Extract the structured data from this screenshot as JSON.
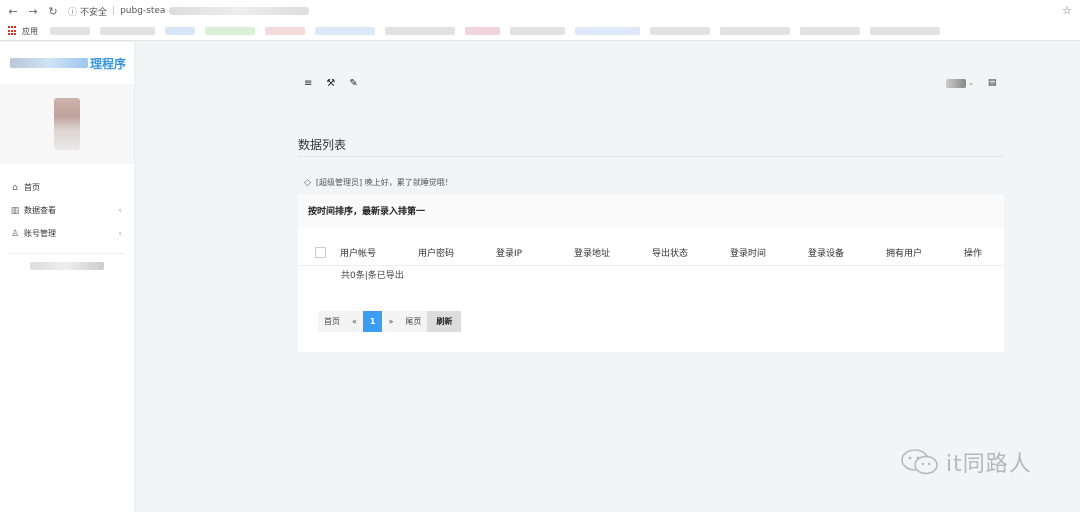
{
  "browser": {
    "security_label": "不安全",
    "url_text": "pubg-stea",
    "bookmarks_label": "应用"
  },
  "sidebar": {
    "brand_suffix": "理程序",
    "menu": [
      {
        "label": "首页",
        "icon": "home-icon"
      },
      {
        "label": "数据查看",
        "icon": "bar-chart-icon"
      },
      {
        "label": "账号管理",
        "icon": "user-icon"
      }
    ]
  },
  "main": {
    "page_title": "数据列表",
    "greeting": "[超级管理员] 晚上好，累了就睡觉哦！",
    "panel_title": "按时间排序，最新录入排第一",
    "table": {
      "columns": [
        "用户帐号",
        "用户密码",
        "登录IP",
        "登录地址",
        "导出状态",
        "登录时间",
        "登录设备",
        "拥有用户",
        "操作"
      ],
      "empty_text": "共0条|条已导出"
    },
    "pager": {
      "first": "首页",
      "prev": "«",
      "current": "1",
      "next": "»",
      "last": "尾页",
      "refresh": "刷新"
    }
  },
  "watermark": {
    "text": "it同路人"
  },
  "colors": {
    "accent": "#3a9ef5",
    "brand": "#3a96dd",
    "background": "#f3f4f6"
  }
}
